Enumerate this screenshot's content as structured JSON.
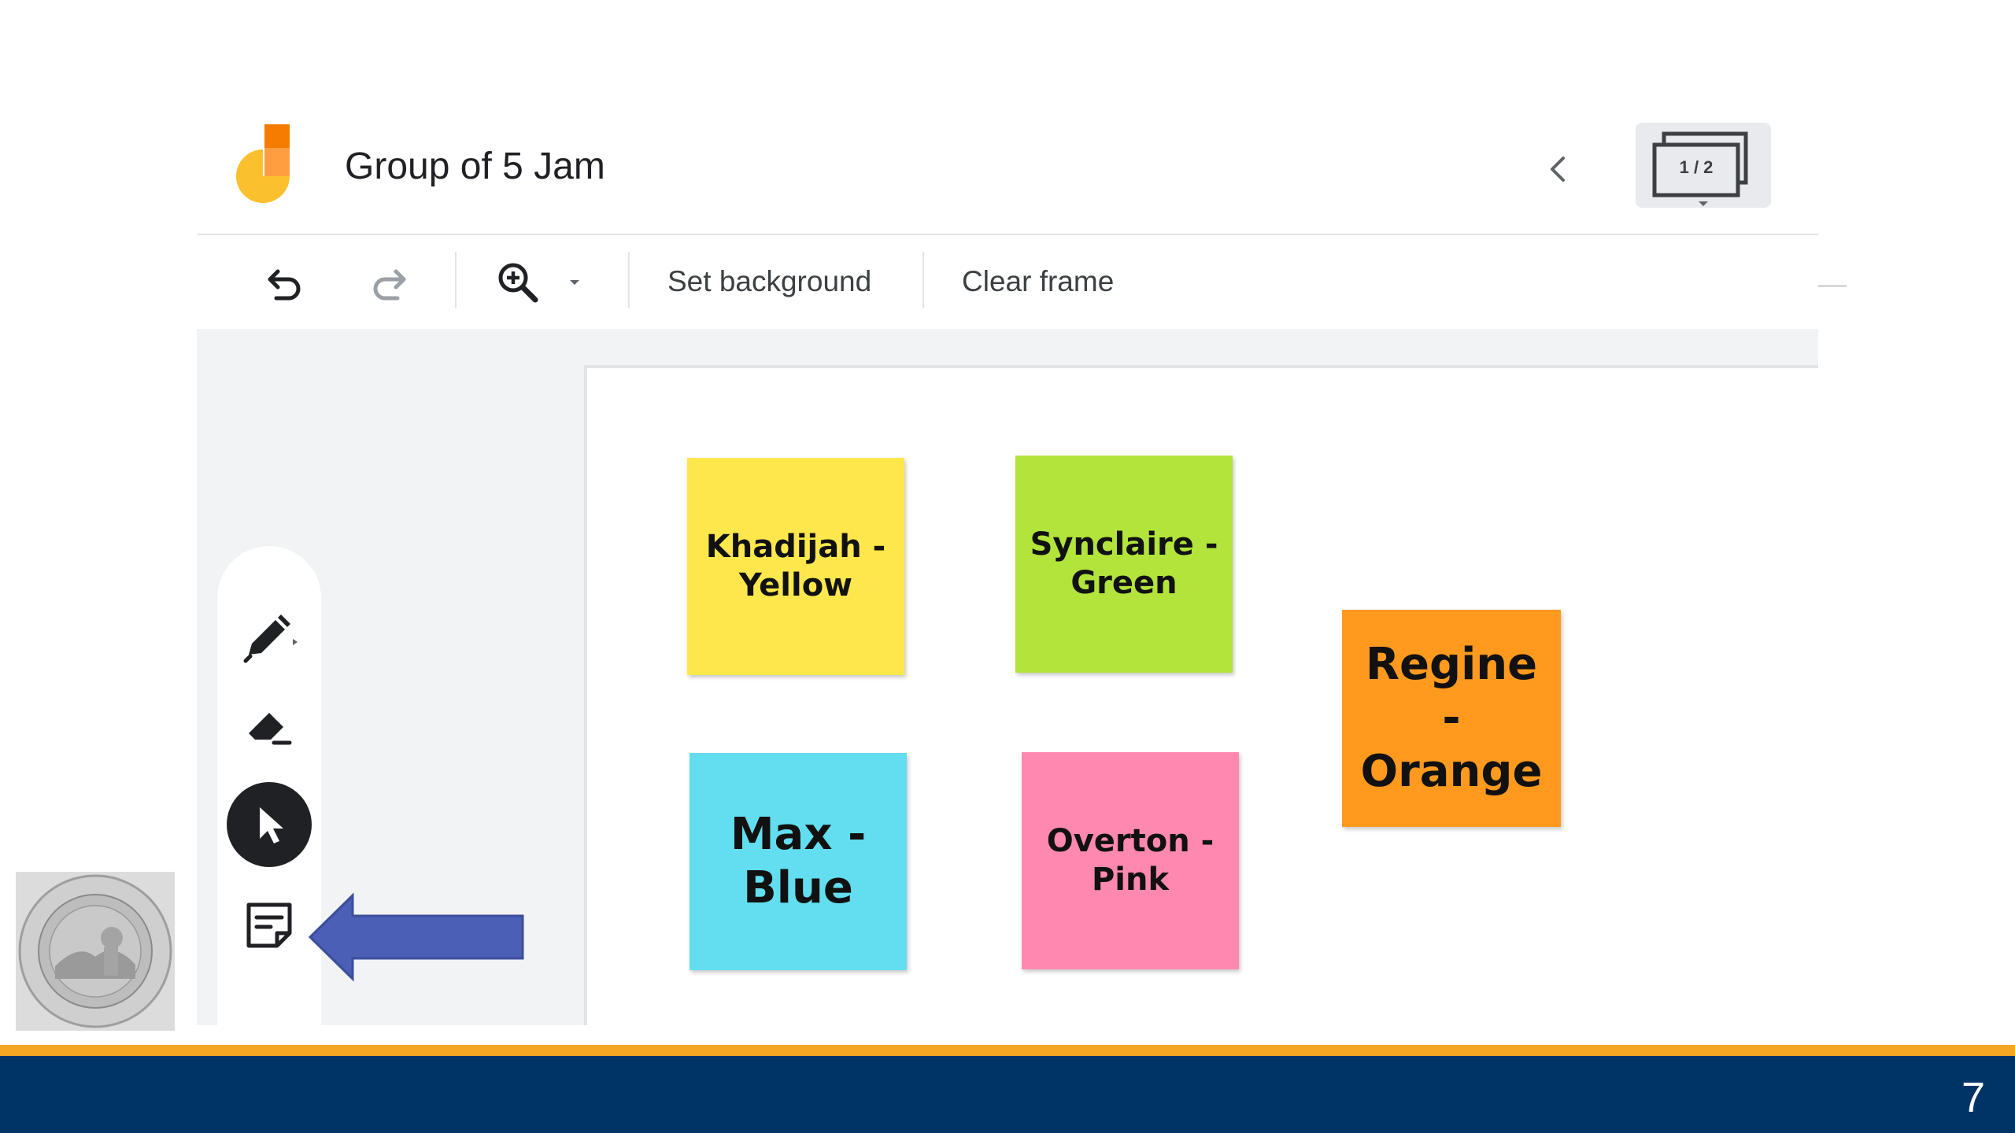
{
  "app": {
    "title": "Group of 5 Jam",
    "frame_counter": "1 / 2"
  },
  "toolbar": {
    "undo_icon": "undo-icon",
    "redo_icon": "redo-icon",
    "zoom_icon": "zoom-in-icon",
    "set_background": "Set background",
    "clear_frame": "Clear frame"
  },
  "tools": [
    {
      "name": "pen",
      "icon": "pen-icon"
    },
    {
      "name": "eraser",
      "icon": "eraser-icon"
    },
    {
      "name": "select",
      "icon": "cursor-icon",
      "active": true
    },
    {
      "name": "sticky-note",
      "icon": "sticky-note-icon"
    }
  ],
  "notes": [
    {
      "text": "Khadijah - Yellow",
      "color": "#fde74c"
    },
    {
      "text": "Synclaire - Green",
      "color": "#b2e43c"
    },
    {
      "text": "Regine - Orange",
      "color": "#ff9a1f"
    },
    {
      "text": "Max - Blue",
      "color": "#62def0"
    },
    {
      "text": "Overton - Pink",
      "color": "#ff88b0"
    }
  ],
  "footer": {
    "slide_number": "7",
    "accent_color": "#f5a623",
    "bar_color": "#003366"
  }
}
